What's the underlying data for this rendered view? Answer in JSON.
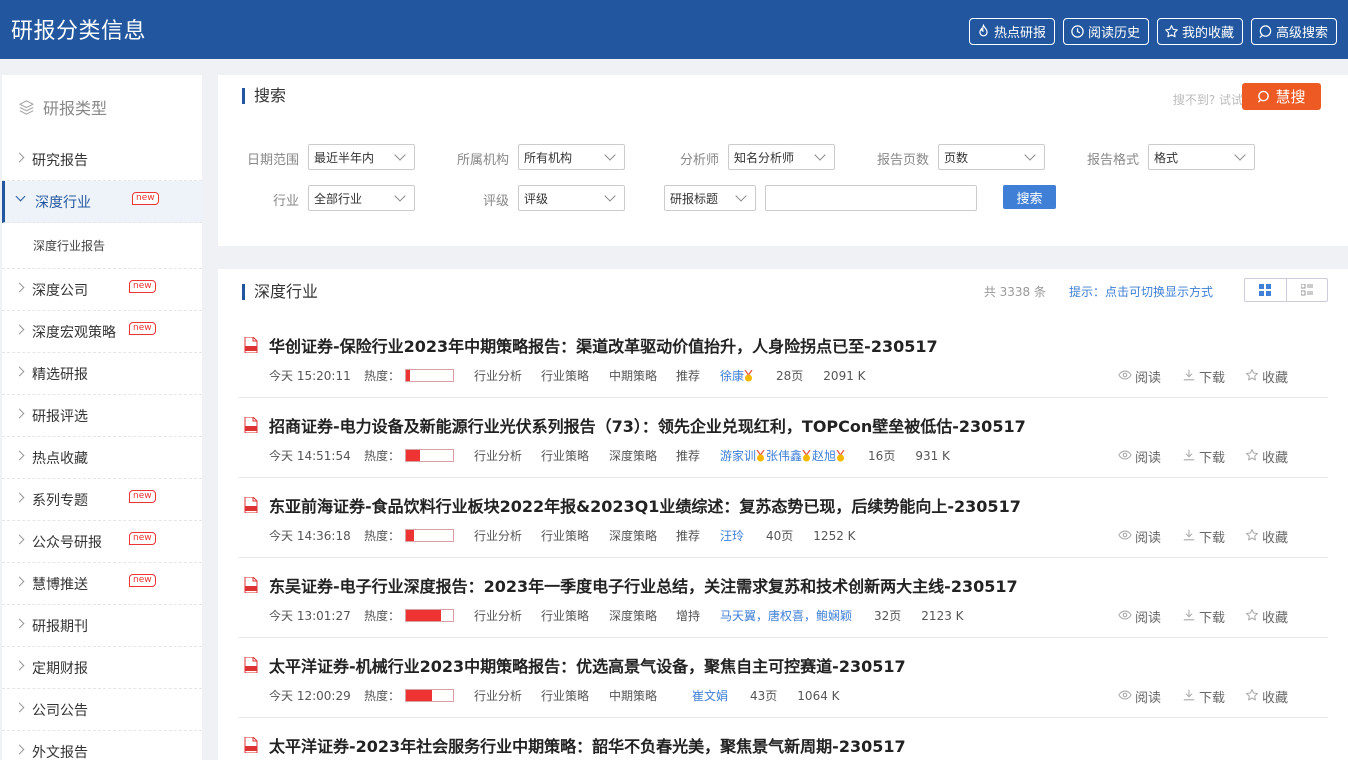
{
  "header": {
    "title": "研报分类信息",
    "actions": [
      {
        "label": "热点研报",
        "icon": "fire-icon"
      },
      {
        "label": "阅读历史",
        "icon": "clock-icon"
      },
      {
        "label": "我的收藏",
        "icon": "star-icon"
      },
      {
        "label": "高级搜索",
        "icon": "search-icon"
      }
    ]
  },
  "sidebar": {
    "heading": "研报类型",
    "badge": "new",
    "items": [
      {
        "label": "研究报告",
        "new": false
      },
      {
        "label": "深度行业",
        "new": true,
        "active": true
      },
      {
        "label": "深度公司",
        "new": true
      },
      {
        "label": "深度宏观策略",
        "new": true
      },
      {
        "label": "精选研报",
        "new": false
      },
      {
        "label": "研报评选",
        "new": false
      },
      {
        "label": "热点收藏",
        "new": false
      },
      {
        "label": "系列专题",
        "new": true
      },
      {
        "label": "公众号研报",
        "new": true
      },
      {
        "label": "慧博推送",
        "new": true
      },
      {
        "label": "研报期刊",
        "new": false
      },
      {
        "label": "定期财报",
        "new": false
      },
      {
        "label": "公司公告",
        "new": false
      },
      {
        "label": "外文报告",
        "new": false
      }
    ],
    "sub_item": "深度行业报告"
  },
  "search": {
    "title": "搜索",
    "hint": "搜不到? 试试",
    "hui_label": "慧搜",
    "filters": {
      "date_label": "日期范围",
      "date_value": "最近半年内",
      "org_label": "所属机构",
      "org_value": "所有机构",
      "analyst_label": "分析师",
      "analyst_value": "知名分析师",
      "pages_label": "报告页数",
      "pages_value": "页数",
      "format_label": "报告格式",
      "format_value": "格式",
      "industry_label": "行业",
      "industry_value": "全部行业",
      "rating_label": "评级",
      "rating_value": "评级",
      "field_value": "研报标题",
      "keyword_value": ""
    },
    "button": "搜索"
  },
  "list": {
    "title": "深度行业",
    "total": "共 3338 条",
    "switch_hint": "提示：点击可切换显示方式",
    "heat_label": "热度：",
    "actions": {
      "read": "阅读",
      "download": "下载",
      "favorite": "收藏"
    },
    "reports": [
      {
        "title": "华创证券-保险行业2023年中期策略报告：渠道改革驱动价值抬升，人身险拐点已至-230517",
        "time": "今天 15:20:11",
        "heat": 0.08,
        "tag1": "行业分析",
        "tag2": "行业策略",
        "tag3": "中期策略",
        "rating": "推荐",
        "authors": [
          {
            "name": "徐康",
            "medal": true
          }
        ],
        "pages": "28页",
        "size": "2091 K"
      },
      {
        "title": "招商证券-电力设备及新能源行业光伏系列报告（73）：领先企业兑现红利，TOPCon壁垒被低估-230517",
        "time": "今天 14:51:54",
        "heat": 0.3,
        "tag1": "行业分析",
        "tag2": "行业策略",
        "tag3": "深度策略",
        "rating": "推荐",
        "authors": [
          {
            "name": "游家训",
            "medal": true
          },
          {
            "name": "张伟鑫",
            "medal": true
          },
          {
            "name": "赵旭",
            "medal": true
          }
        ],
        "pages": "16页",
        "size": "931 K"
      },
      {
        "title": "东亚前海证券-食品饮料行业板块2022年报&2023Q1业绩综述：复苏态势已现，后续势能向上-230517",
        "time": "今天 14:36:18",
        "heat": 0.18,
        "tag1": "行业分析",
        "tag2": "行业策略",
        "tag3": "深度策略",
        "rating": "推荐",
        "authors": [
          {
            "name": "汪玲",
            "medal": false
          }
        ],
        "pages": "40页",
        "size": "1252 K"
      },
      {
        "title": "东吴证券-电子行业深度报告：2023年一季度电子行业总结，关注需求复苏和技术创新两大主线-230517",
        "time": "今天 13:01:27",
        "heat": 0.75,
        "tag1": "行业分析",
        "tag2": "行业策略",
        "tag3": "深度策略",
        "rating": "增持",
        "authors": [
          {
            "name": "马天翼，唐权喜，鲍娴颖",
            "medal": false
          }
        ],
        "pages": "32页",
        "size": "2123 K"
      },
      {
        "title": "太平洋证券-机械行业2023中期策略报告：优选高景气设备，聚焦自主可控赛道-230517",
        "time": "今天 12:00:29",
        "heat": 0.55,
        "tag1": "行业分析",
        "tag2": "行业策略",
        "tag3": "中期策略",
        "rating": "",
        "authors": [
          {
            "name": "崔文娟",
            "medal": false
          }
        ],
        "pages": "43页",
        "size": "1064 K"
      },
      {
        "title": "太平洋证券-2023年社会服务行业中期策略：韶华不负春光美，聚焦景气新周期-230517"
      }
    ]
  }
}
